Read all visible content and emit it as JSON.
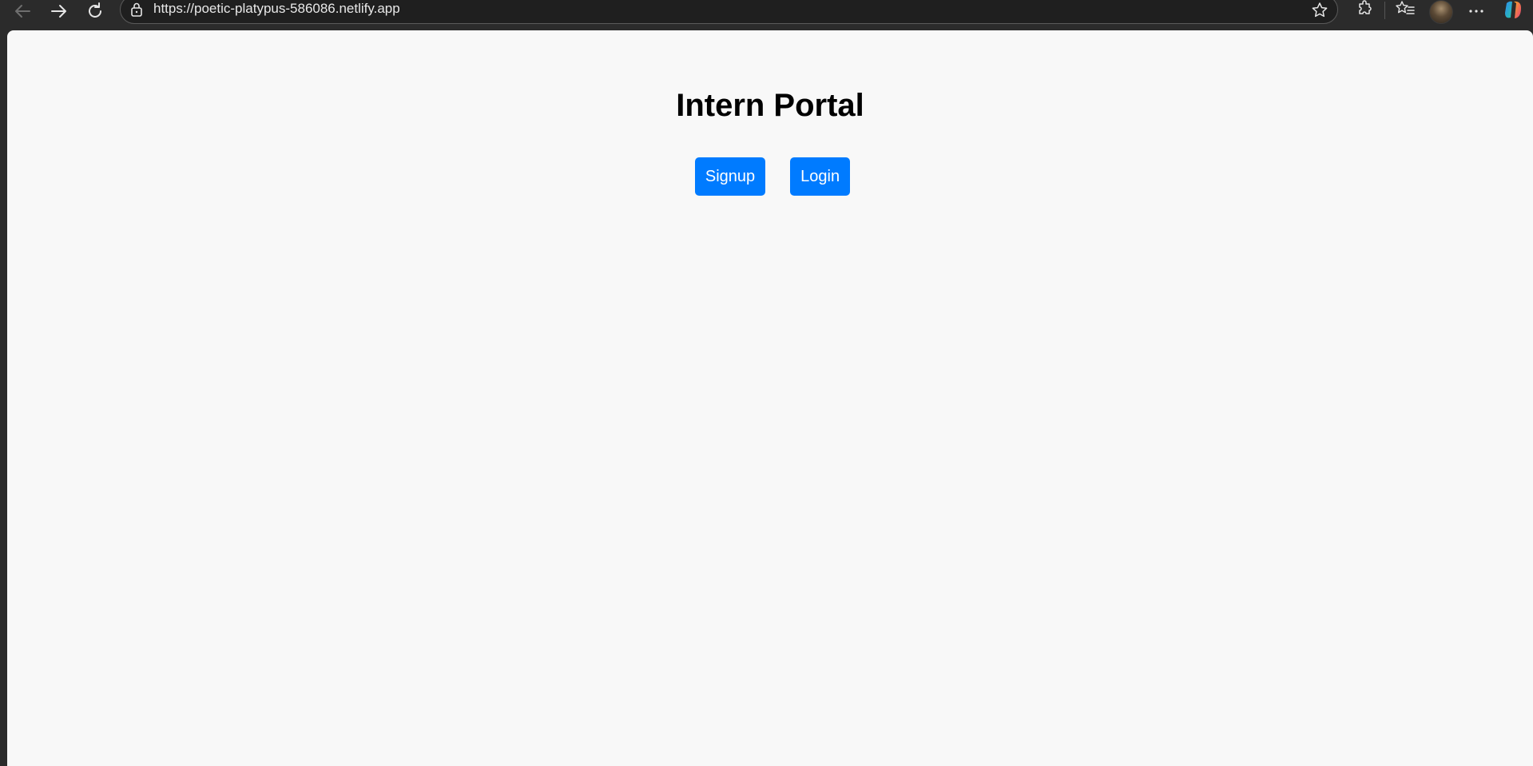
{
  "browser": {
    "url": "https://poetic-platypus-586086.netlify.app",
    "icons": [
      "back-icon",
      "forward-icon",
      "reload-icon",
      "lock-icon",
      "star-icon",
      "extensions-icon",
      "favorites-icon",
      "avatar",
      "more-icon",
      "copilot-icon"
    ]
  },
  "page": {
    "title": "Intern Portal",
    "signup_label": "Signup",
    "login_label": "Login",
    "background": "#f8f8f8",
    "button_color": "#007bff"
  }
}
